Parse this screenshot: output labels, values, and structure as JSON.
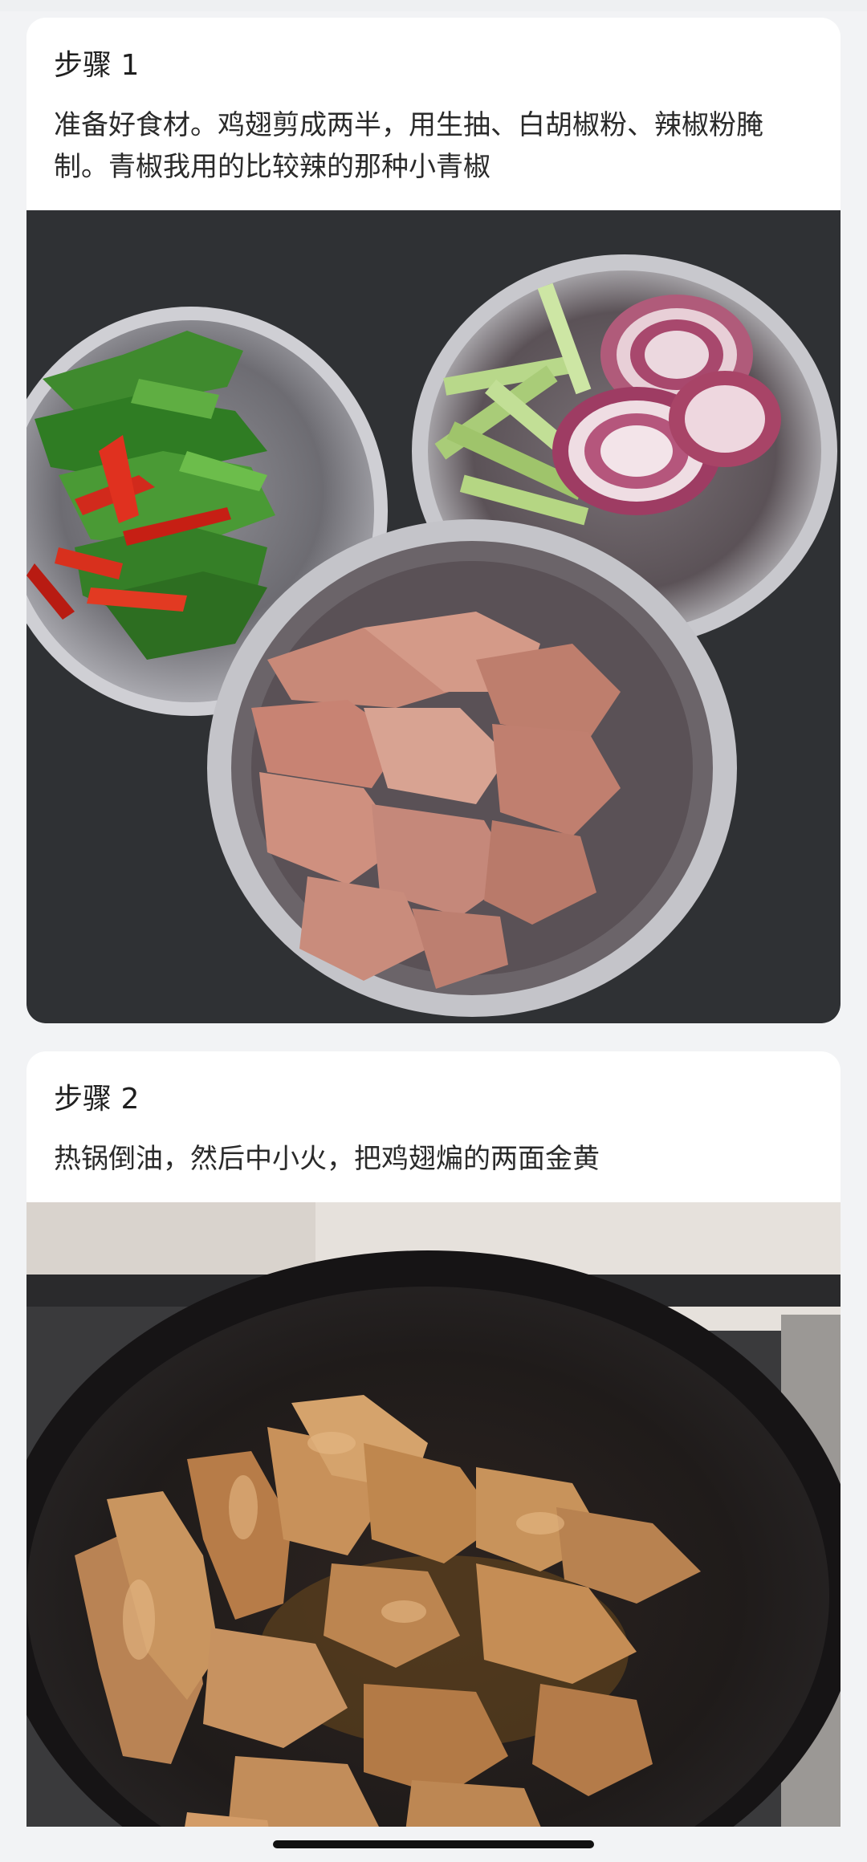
{
  "steps": [
    {
      "title": "步骤 1",
      "description": "准备好食材。鸡翅剪成两半，用生抽、白胡椒粉、辣椒粉腌制。青椒我用的比较辣的那种小青椒",
      "image_icon": "ingredients-photo"
    },
    {
      "title": "步骤 2",
      "description": "热锅倒油，然后中小火，把鸡翅煸的两面金黄",
      "image_icon": "frying-wings-photo"
    }
  ],
  "colors": {
    "page_background": "#f2f3f5",
    "card_background": "#ffffff",
    "text": "#222222"
  }
}
